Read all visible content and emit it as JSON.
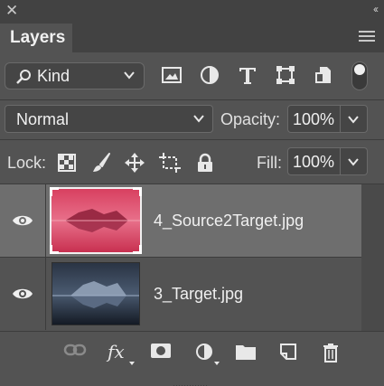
{
  "panel": {
    "title_close": "✕",
    "collapse": "‹‹",
    "tab_label": "Layers"
  },
  "filter": {
    "kind_label": "Kind",
    "icons": [
      "image-filter-icon",
      "adjustment-filter-icon",
      "type-filter-icon",
      "shape-filter-icon",
      "smart-object-filter-icon",
      "filter-toggle-switch"
    ]
  },
  "blend": {
    "mode": "Normal",
    "opacity_label": "Opacity:",
    "opacity_value": "100%"
  },
  "lock": {
    "label": "Lock:",
    "icons": [
      "lock-transparent-pixels-icon",
      "lock-image-pixels-icon",
      "lock-position-icon",
      "lock-artboard-icon",
      "lock-all-icon"
    ],
    "fill_label": "Fill:",
    "fill_value": "100%"
  },
  "layers": [
    {
      "name": "4_Source2Target.jpg",
      "visible": true,
      "selected": true,
      "thumb_colors": [
        "#c83a5a",
        "#e0607a"
      ]
    },
    {
      "name": "3_Target.jpg",
      "visible": true,
      "selected": false,
      "thumb_colors": [
        "#1c2430",
        "#5a6a80"
      ]
    }
  ],
  "bottom_icons": [
    "link-layers-icon",
    "fx-icon",
    "add-mask-icon",
    "new-adjustment-layer-icon",
    "new-group-folder-icon",
    "new-layer-icon",
    "delete-layer-trash-icon"
  ],
  "fx_label": "fx",
  "colors": {
    "panel_bg": "#535353",
    "header_bg": "#424242",
    "selected_row": "#6e6e6e",
    "text": "#f0f0f0"
  }
}
